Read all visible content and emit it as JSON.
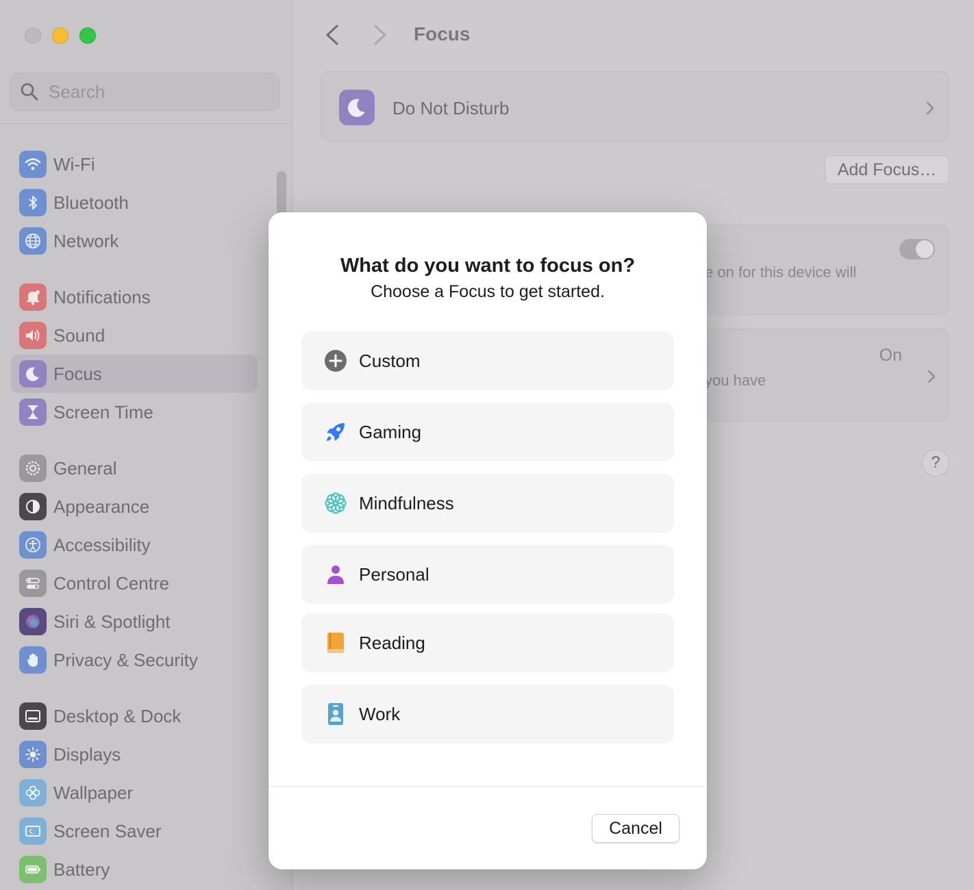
{
  "window": {
    "traffic_lights": [
      "close",
      "minimize",
      "zoom"
    ]
  },
  "sidebar": {
    "search_placeholder": "Search",
    "items": [
      {
        "label": "Wi-Fi",
        "icon": "wifi-icon",
        "color": "#6e8fd0"
      },
      {
        "label": "Bluetooth",
        "icon": "bluetooth-icon",
        "color": "#6e8fd0"
      },
      {
        "label": "Network",
        "icon": "globe-icon",
        "color": "#6e8fd0"
      },
      {
        "label": "Notifications",
        "icon": "bell-icon",
        "color": "#d9767a"
      },
      {
        "label": "Sound",
        "icon": "speaker-icon",
        "color": "#d9767a"
      },
      {
        "label": "Focus",
        "icon": "moon-icon",
        "color": "#8f84c0",
        "selected": true
      },
      {
        "label": "Screen Time",
        "icon": "hourglass-icon",
        "color": "#8f84c0"
      },
      {
        "label": "General",
        "icon": "gear-icon",
        "color": "#9a989b"
      },
      {
        "label": "Appearance",
        "icon": "appearance-icon",
        "color": "#4a484b"
      },
      {
        "label": "Accessibility",
        "icon": "accessibility-icon",
        "color": "#6e8fd0"
      },
      {
        "label": "Control Centre",
        "icon": "toggles-icon",
        "color": "#9a989b"
      },
      {
        "label": "Siri & Spotlight",
        "icon": "siri-icon",
        "color": "#7a6ab0"
      },
      {
        "label": "Privacy & Security",
        "icon": "hand-icon",
        "color": "#6e8fd0"
      },
      {
        "label": "Desktop & Dock",
        "icon": "dock-icon",
        "color": "#4a484b"
      },
      {
        "label": "Displays",
        "icon": "sun-icon",
        "color": "#6e8fd0"
      },
      {
        "label": "Wallpaper",
        "icon": "flower-icon",
        "color": "#7fb0d8"
      },
      {
        "label": "Screen Saver",
        "icon": "screensaver-icon",
        "color": "#7fb0d8"
      },
      {
        "label": "Battery",
        "icon": "battery-icon",
        "color": "#7dbf6e"
      }
    ]
  },
  "main": {
    "title": "Focus",
    "dnd_label": "Do Not Disturb",
    "add_focus_label": "Add Focus…",
    "share_text": "e on for this device will",
    "status_on": "On",
    "status_text": "you have",
    "help_label": "?"
  },
  "modal": {
    "title": "What do you want to focus on?",
    "subtitle": "Choose a Focus to get started.",
    "options": [
      {
        "label": "Custom",
        "icon": "plus-circle-icon",
        "color": "#6d6d70"
      },
      {
        "label": "Gaming",
        "icon": "rocket-icon",
        "color": "#3478f6"
      },
      {
        "label": "Mindfulness",
        "icon": "flower-icon",
        "color": "#4fc3c0"
      },
      {
        "label": "Personal",
        "icon": "person-icon",
        "color": "#a650d6"
      },
      {
        "label": "Reading",
        "icon": "book-icon",
        "color": "#f0a53a"
      },
      {
        "label": "Work",
        "icon": "id-badge-icon",
        "color": "#5aa3c8"
      }
    ],
    "cancel_label": "Cancel"
  }
}
